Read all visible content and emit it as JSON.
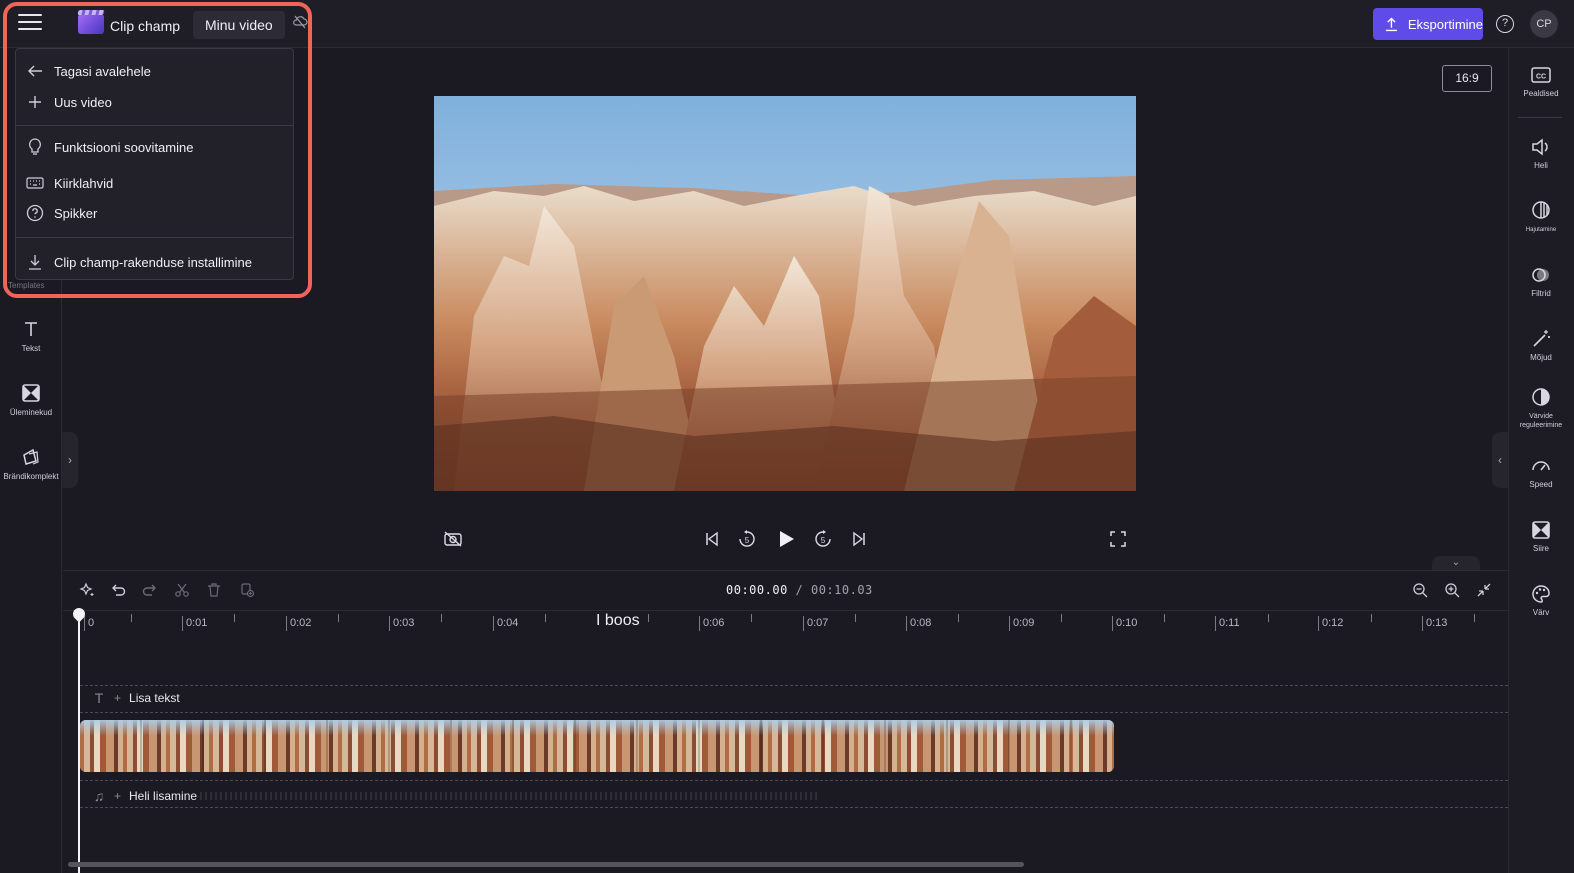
{
  "app": {
    "title": "Clip champ",
    "video_name": "Minu video",
    "export_label": "Eksportimine",
    "help_label": "?",
    "avatar_initials": "CP"
  },
  "menu": {
    "back_label": "Tagasi avalehele",
    "new_video_label": "Uus video",
    "feature_request_label": "Funktsiooni soovitamine",
    "shortcuts_label": "Kiirklahvid",
    "help_label": "Spikker",
    "install_label": "Clip champ-rakenduse installimine"
  },
  "left_sidebar": {
    "templates_label": "Templates",
    "items": [
      {
        "label": "Tekst",
        "icon": "text-icon"
      },
      {
        "label": "Üleminekud",
        "icon": "transitions-icon"
      },
      {
        "label": "Brändikomplekt",
        "icon": "brand-kit-icon"
      }
    ]
  },
  "preview": {
    "aspect_ratio": "16:9"
  },
  "right_sidebar": {
    "items": [
      {
        "label": "Pealdised",
        "icon": "captions-icon"
      },
      {
        "label": "Heli",
        "icon": "audio-icon"
      },
      {
        "label": "Hajutamine",
        "icon": "fade-icon"
      },
      {
        "label": "Filtrid",
        "icon": "filters-icon"
      },
      {
        "label": "Mõjud",
        "icon": "effects-icon"
      },
      {
        "label": "Värvide reguleerimine",
        "icon": "color-adjust-icon"
      },
      {
        "label": "Speed",
        "icon": "speed-icon"
      },
      {
        "label": "Siire",
        "icon": "transition-icon"
      },
      {
        "label": "Värv",
        "icon": "palette-icon"
      }
    ]
  },
  "timeline": {
    "current_time": "00:00.00",
    "separator": " / ",
    "total_time": "00:10.03",
    "ticks": [
      "0",
      "0:01",
      "0:02",
      "0:03",
      "0:04",
      "0:06",
      "0:07",
      "0:08",
      "0:09",
      "0:10",
      "0:11",
      "0:12",
      "0:13"
    ],
    "big_label": "I boos",
    "add_text_label": "Lisa tekst",
    "add_audio_label": "Heli lisamine"
  }
}
